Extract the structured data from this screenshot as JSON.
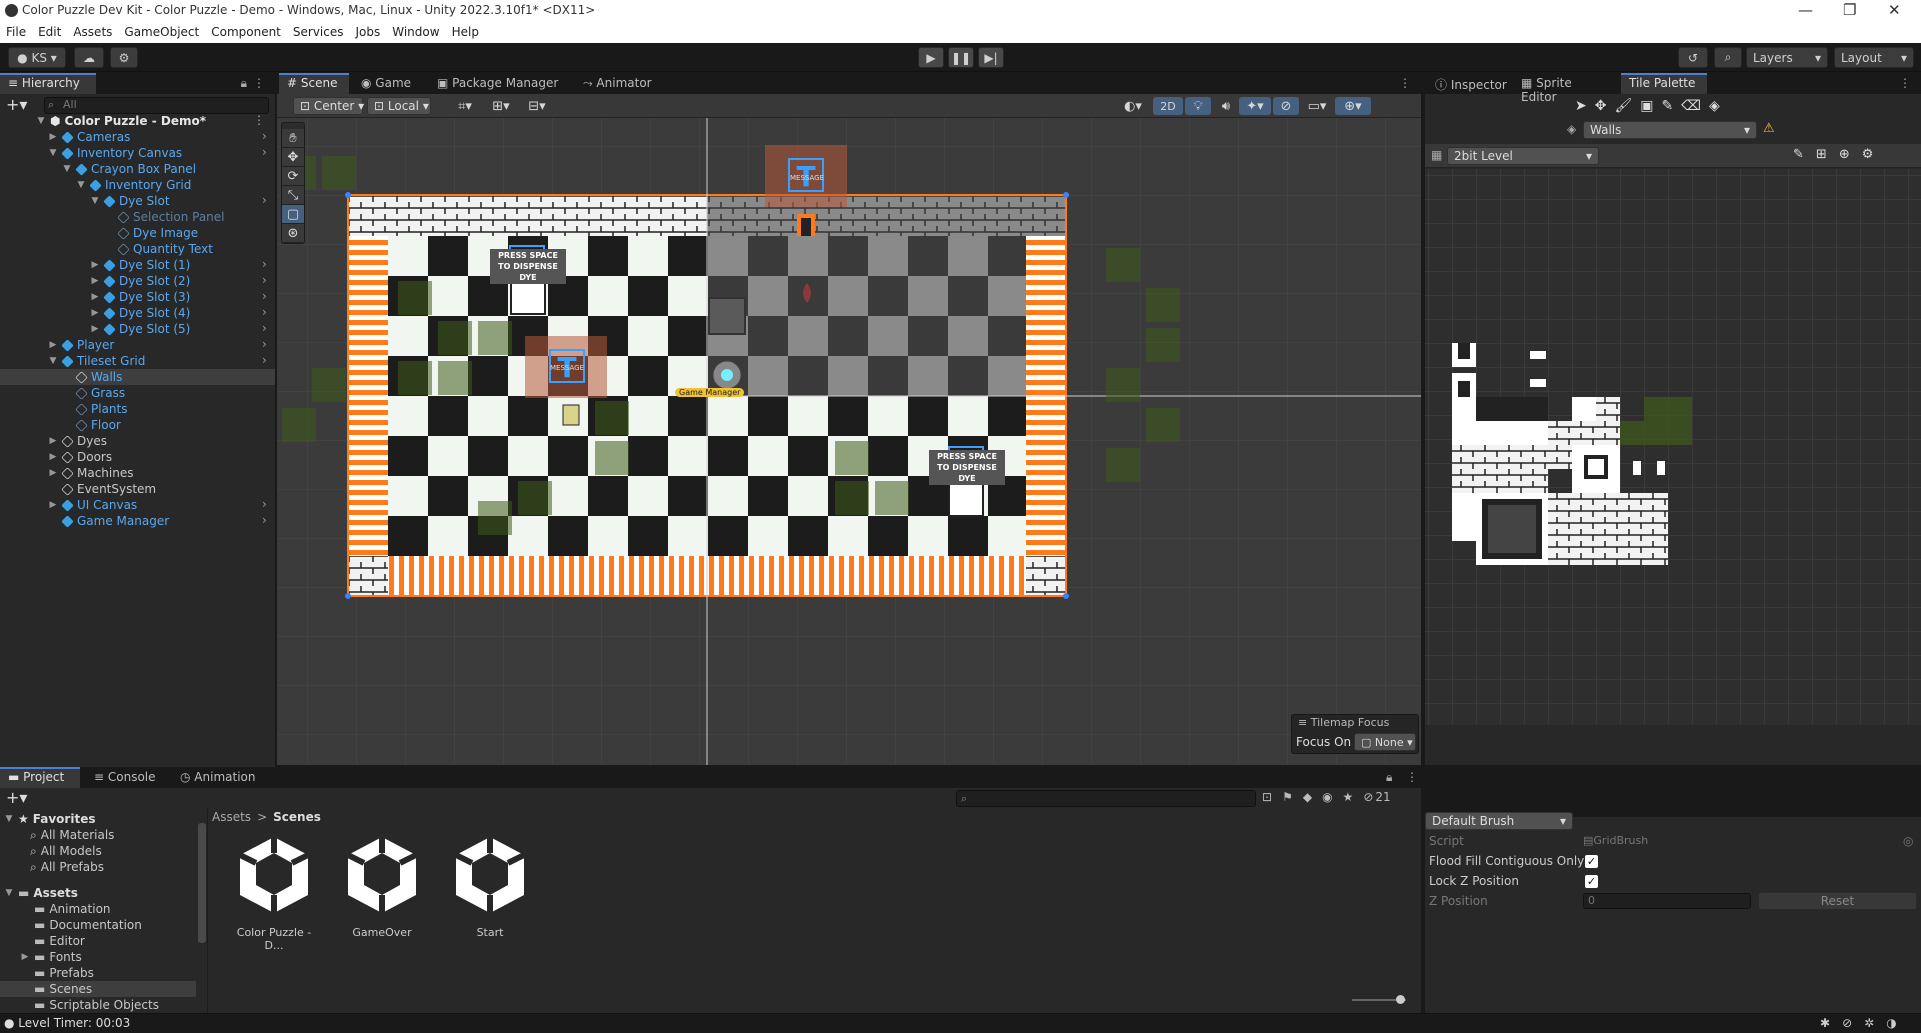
{
  "window": {
    "title": "Color Puzzle Dev Kit - Color Puzzle - Demo - Windows, Mac, Linux - Unity 2022.3.10f1* <DX11>"
  },
  "menu": [
    "File",
    "Edit",
    "Assets",
    "GameObject",
    "Component",
    "Services",
    "Jobs",
    "Window",
    "Help"
  ],
  "toolbar": {
    "account": "KS",
    "layers": "Layers",
    "layout": "Layout"
  },
  "hierarchy": {
    "tab": "Hierarchy",
    "search_placeholder": "All",
    "scene": "Color Puzzle - Demo*",
    "items": [
      {
        "label": "Cameras"
      },
      {
        "label": "Inventory Canvas"
      },
      {
        "label": "Crayon Box Panel"
      },
      {
        "label": "Inventory Grid"
      },
      {
        "label": "Dye Slot"
      },
      {
        "label": "Selection Panel"
      },
      {
        "label": "Dye Image"
      },
      {
        "label": "Quantity Text"
      },
      {
        "label": "Dye Slot (1)"
      },
      {
        "label": "Dye Slot (2)"
      },
      {
        "label": "Dye Slot (3)"
      },
      {
        "label": "Dye Slot (4)"
      },
      {
        "label": "Dye Slot (5)"
      },
      {
        "label": "Player"
      },
      {
        "label": "Tileset Grid"
      },
      {
        "label": "Walls"
      },
      {
        "label": "Grass"
      },
      {
        "label": "Plants"
      },
      {
        "label": "Floor"
      },
      {
        "label": "Dyes"
      },
      {
        "label": "Doors"
      },
      {
        "label": "Machines"
      },
      {
        "label": "EventSystem"
      },
      {
        "label": "UI Canvas"
      },
      {
        "label": "Game Manager"
      }
    ]
  },
  "center_tabs": [
    "Scene",
    "Game",
    "Package Manager",
    "Animator"
  ],
  "scene_toolbar": {
    "pivot": "Center",
    "space": "Local",
    "mode2d": "2D"
  },
  "scene": {
    "press_space_text": "PRESS SPACE TO DISPENSE DYE",
    "message_text": "MESSAGE",
    "game_manager_label": "Game Manager",
    "tilemap_focus_title": "Tilemap Focus",
    "focus_on_label": "Focus On",
    "focus_on_value": "None"
  },
  "right_tabs": [
    "Inspector",
    "Sprite Editor",
    "Tile Palette"
  ],
  "tile_palette": {
    "active_tilemap": "Walls",
    "palette": "2bit Level",
    "brush": "Default Brush",
    "props": {
      "script_label": "Script",
      "script_value": "GridBrush",
      "flood_label": "Flood Fill Contiguous Only",
      "lockz_label": "Lock Z Position",
      "zpos_label": "Z Position",
      "zpos_value": "0",
      "reset_label": "Reset"
    }
  },
  "bottom_tabs": [
    "Project",
    "Console",
    "Animation"
  ],
  "project": {
    "favorites_label": "Favorites",
    "favorites": [
      "All Materials",
      "All Models",
      "All Prefabs"
    ],
    "assets_label": "Assets",
    "folders": [
      "Animation",
      "Documentation",
      "Editor",
      "Fonts",
      "Prefabs",
      "Scenes",
      "Scriptable Objects"
    ],
    "breadcrumb": [
      "Assets",
      "Scenes"
    ],
    "breadcrumb_sep": ">",
    "scenes": [
      "Color Puzzle - D...",
      "GameOver",
      "Start"
    ],
    "hidden_count": "21"
  },
  "status": {
    "text": "Level Timer: 00:03"
  },
  "colors": {
    "accent": "#4b7fd1",
    "hierarchy_blue": "#5aa8ef",
    "border_orange": "#ff7a1a",
    "selection": "#2c5d87"
  }
}
